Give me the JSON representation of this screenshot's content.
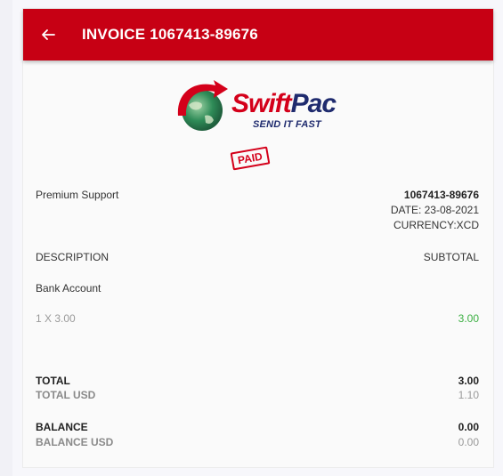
{
  "header": {
    "title": "INVOICE 1067413-89676"
  },
  "logo": {
    "swift": "Swift",
    "pac": "Pac",
    "tagline": "SEND IT FAST",
    "stamp": "PAID"
  },
  "invoice": {
    "customer": "Premium Support",
    "number": "1067413-89676",
    "date": "DATE: 23-08-2021",
    "currency": "CURRENCY:XCD"
  },
  "table": {
    "col_description": "DESCRIPTION",
    "col_subtotal": "SUBTOTAL",
    "items": [
      {
        "name": "Bank Account",
        "qty_price": "1 X 3.00",
        "subtotal": "3.00"
      }
    ]
  },
  "totals": {
    "total_label": "TOTAL",
    "total_value": "3.00",
    "total_usd_label": "TOTAL USD",
    "total_usd_value": "1.10",
    "balance_label": "BALANCE",
    "balance_value": "0.00",
    "balance_usd_label": "BALANCE USD",
    "balance_usd_value": "0.00"
  },
  "colors": {
    "brand_red": "#c70014",
    "brand_navy": "#1f2b6e",
    "amount_green": "#3cb043"
  }
}
